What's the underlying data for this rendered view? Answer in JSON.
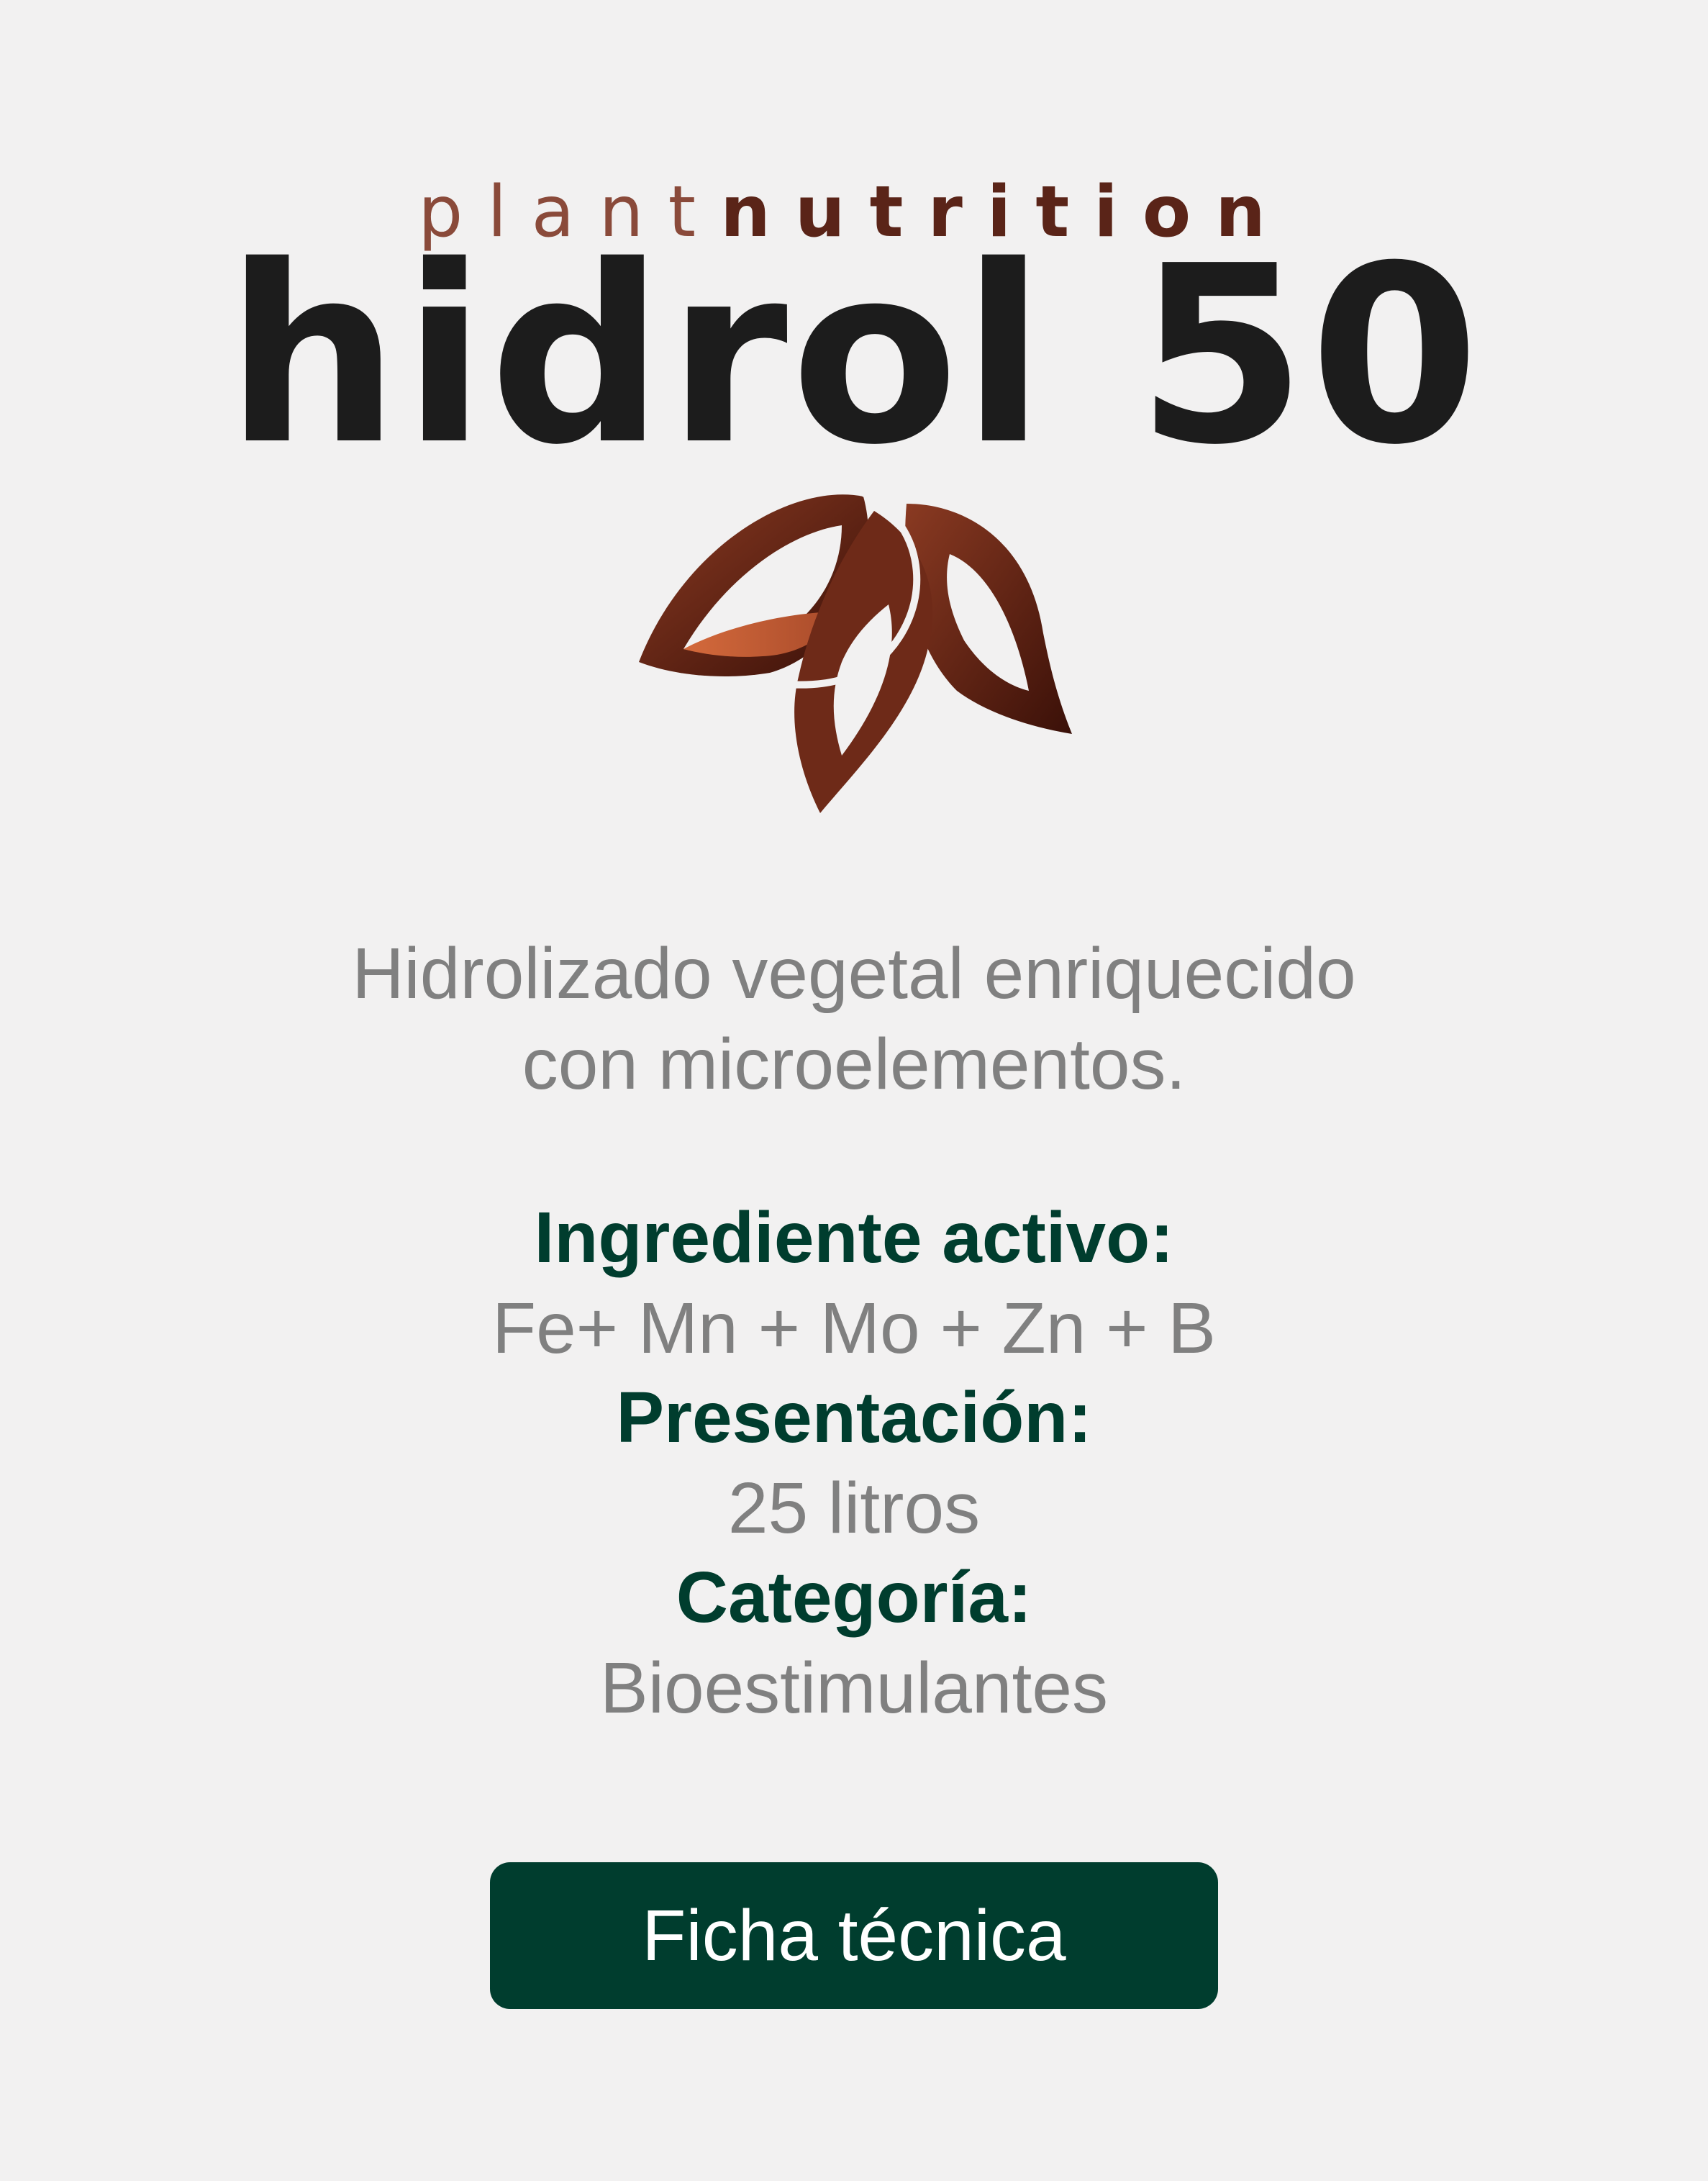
{
  "logo": {
    "brand_prefix": "plant",
    "brand_suffix": "nutrition",
    "product_name": "hidrol 50",
    "mark_icon": "leaf-trio-icon",
    "colors": {
      "brand_dark": "#5a2418",
      "brand_mid": "#7a3a2b",
      "leaf_accent": "#c8623b",
      "product_text": "#1c1c1c"
    }
  },
  "description": {
    "line1": "Hidrolizado vegetal enriquecido",
    "line2": "con microelementos."
  },
  "details": {
    "ingredient_label": "Ingrediente activo:",
    "ingredient_value": "Fe+ Mn + Mo + Zn + B",
    "presentation_label": "Presentación:",
    "presentation_value": "25 litros",
    "category_label": "Categoría:",
    "category_value": "Bioestimulantes"
  },
  "actions": {
    "datasheet_label": "Ficha técnica"
  },
  "colors": {
    "background": "#f2f1f1",
    "accent": "#003d2e",
    "muted_text": "#808080"
  }
}
